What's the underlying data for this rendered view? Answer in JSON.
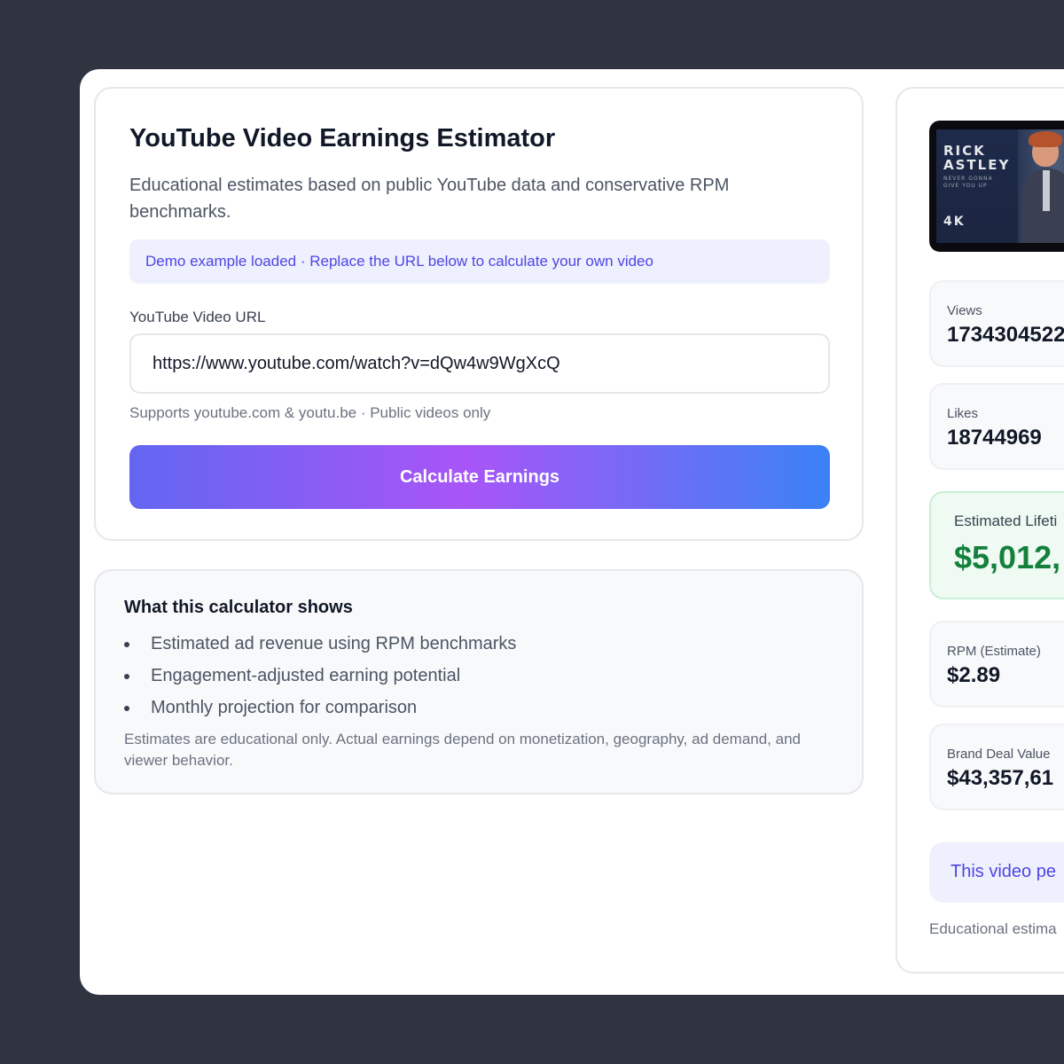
{
  "main": {
    "title": "YouTube Video Earnings Estimator",
    "subtitle": "Educational estimates based on public YouTube data and conservative RPM benchmarks.",
    "notice": "Demo example loaded · Replace the URL below to calculate your own video",
    "url_label": "YouTube Video URL",
    "url_value": "https://www.youtube.com/watch?v=dQw4w9WgXcQ",
    "url_hint": "Supports youtube.com & youtu.be · Public videos only",
    "calculate_label": "Calculate Earnings"
  },
  "info": {
    "title": "What this calculator shows",
    "items": [
      "Estimated ad revenue using RPM benchmarks",
      "Engagement-adjusted earning potential",
      "Monthly projection for comparison"
    ],
    "disclaimer": "Estimates are educational only. Actual earnings depend on monetization, geography, ad demand, and viewer behavior."
  },
  "results": {
    "thumbnail": {
      "artist": "RICK ASTLEY",
      "song": "NEVER GONNA GIVE YOU UP",
      "quality": "4K"
    },
    "views_label": "Views",
    "views_value": "1734304522",
    "likes_label": "Likes",
    "likes_value": "18744969",
    "lifetime_label": "Estimated Lifeti",
    "lifetime_value": "$5,012,",
    "rpm_label": "RPM (Estimate)",
    "rpm_value": "$2.89",
    "brand_label": "Brand Deal Value",
    "brand_value": "$43,357,61",
    "note_text": "This video pe",
    "footer_text": "Educational estima"
  },
  "colors": {
    "accent": "#4f46e5",
    "success": "#15803d",
    "background": "#2f3440"
  }
}
